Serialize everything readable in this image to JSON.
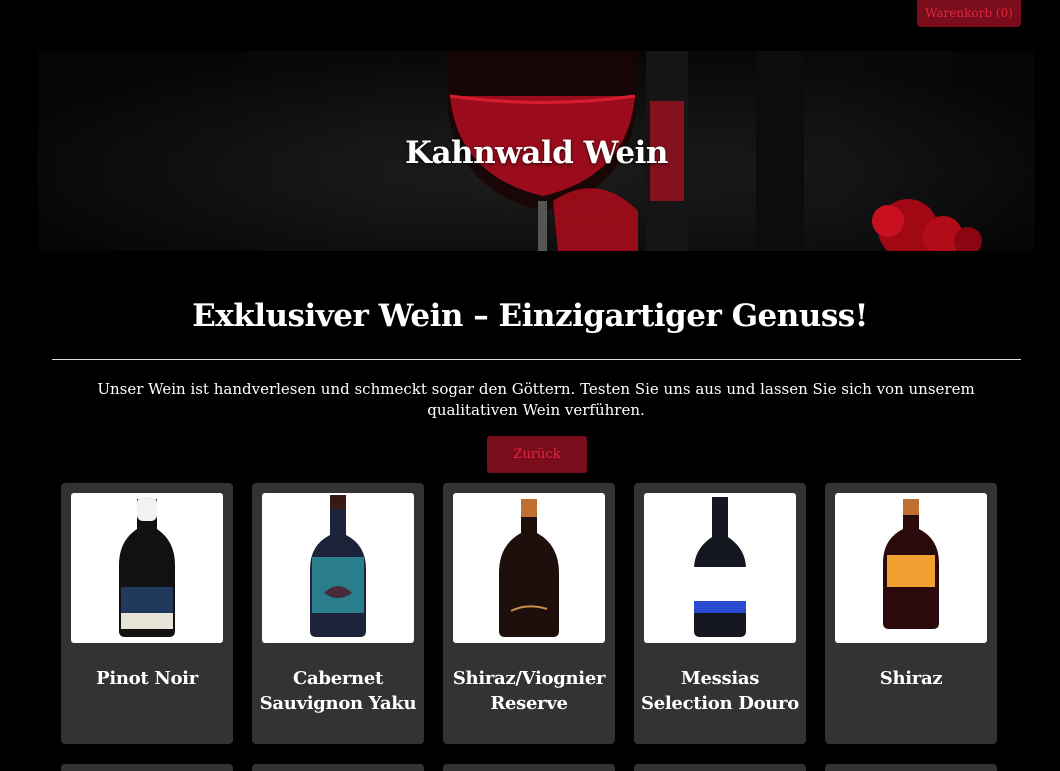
{
  "header": {
    "cart_label": "Warenkorb (0)"
  },
  "hero": {
    "title": "Kahnwald Wein"
  },
  "main": {
    "headline": "Exklusiver Wein – Einzigartiger Genuss!",
    "intro": "Unser Wein ist handverlesen und schmeckt sogar den Göttern. Testen Sie uns aus und lassen Sie sich von unserem qualitativen Wein verführen.",
    "back_label": "Zurück"
  },
  "products": [
    {
      "name": "Pinot Noir",
      "image": "wine-bottle-pinot-noir",
      "label_color": "#1f3a5c"
    },
    {
      "name": "Cabernet Sauvignon Yaku",
      "image": "wine-bottle-yaku",
      "label_color": "#2a7d8a"
    },
    {
      "name": "Shiraz/Viognier Reserve",
      "image": "wine-bottle-shiraz-viognier",
      "label_color": "#2a1a10"
    },
    {
      "name": "Messias Selection Douro",
      "image": "wine-bottle-messias",
      "label_color": "#ffffff"
    },
    {
      "name": "Shiraz",
      "image": "wine-bottle-shiraz",
      "label_color": "#f0a030"
    }
  ],
  "colors": {
    "accent": "#7a0d1c",
    "accent_text": "#e0263f",
    "card_bg": "#333333",
    "page_bg": "#000000"
  }
}
